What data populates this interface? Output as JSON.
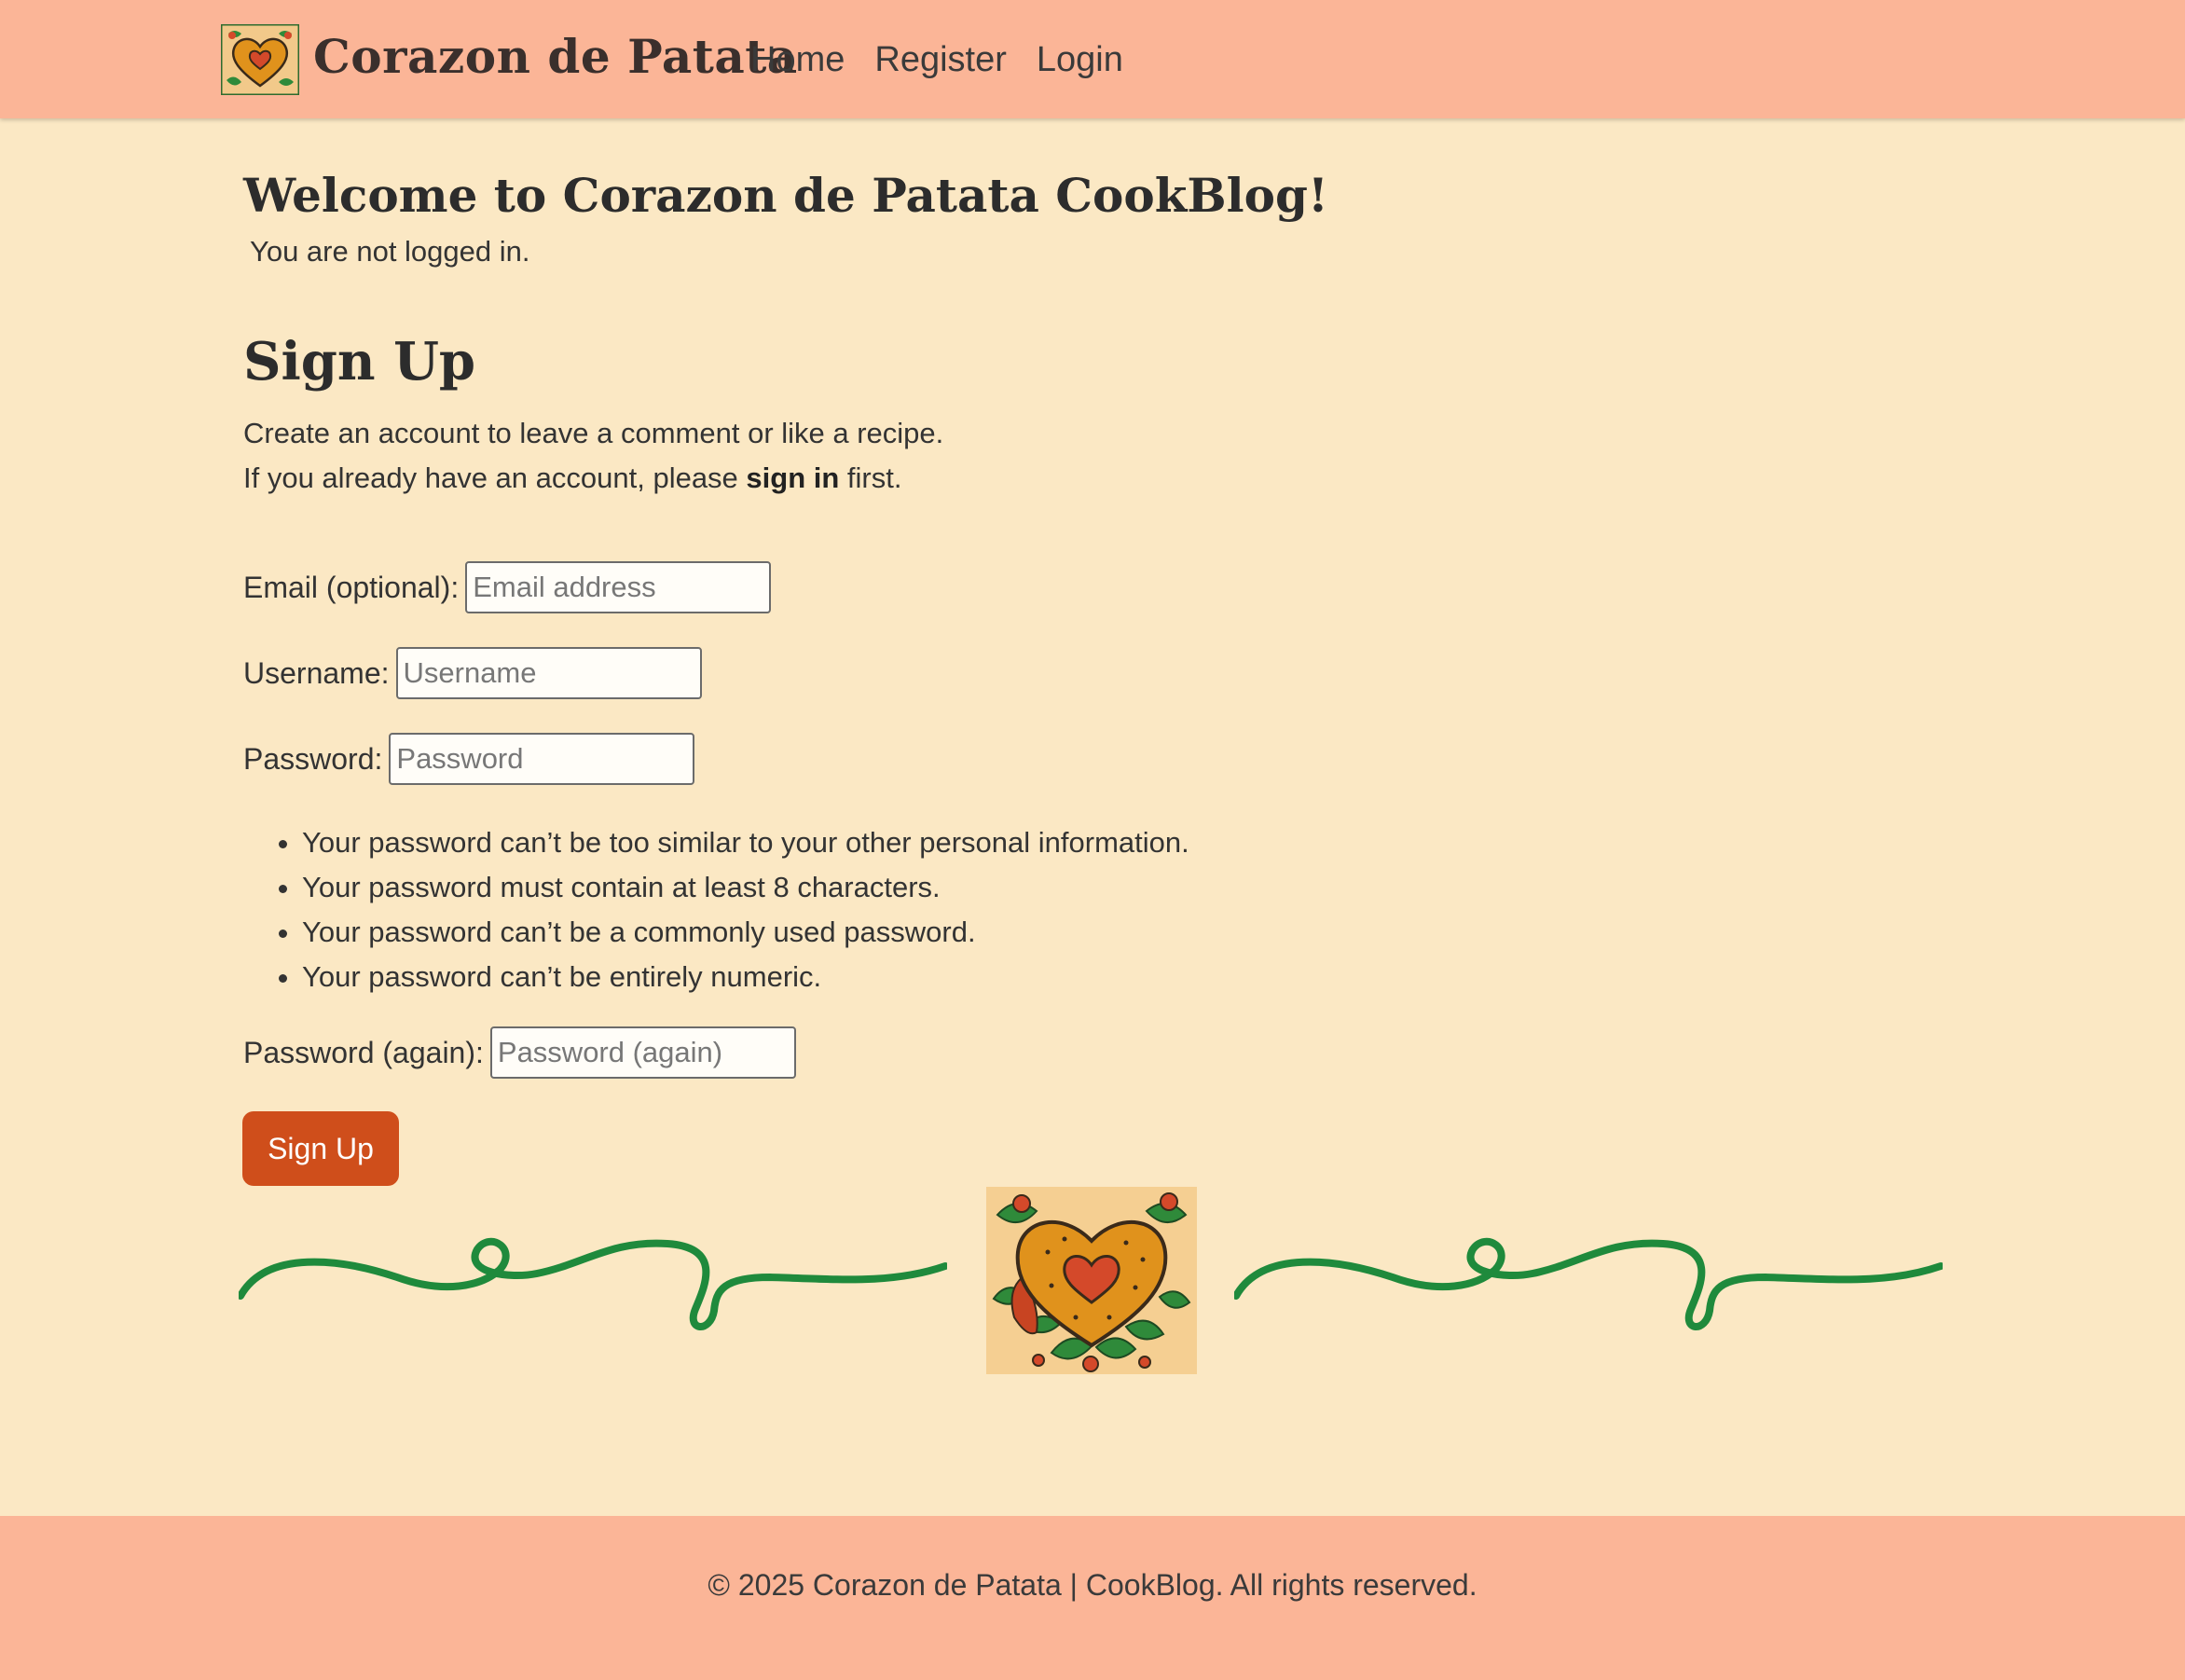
{
  "header": {
    "brand_name": "Corazon de Patata",
    "nav": [
      {
        "label": "Home"
      },
      {
        "label": "Register"
      },
      {
        "label": "Login"
      }
    ]
  },
  "main": {
    "welcome_title": "Welcome to Corazon de Patata CookBlog!",
    "login_status": "You are not logged in.",
    "signup_title": "Sign Up",
    "intro_line1": "Create an account to leave a comment or like a recipe.",
    "intro_line2_before": "If you already have an account, please ",
    "intro_line2_link": "sign in",
    "intro_line2_after": " first."
  },
  "form": {
    "email": {
      "label": "Email (optional):",
      "placeholder": "Email address",
      "value": ""
    },
    "username": {
      "label": "Username:",
      "placeholder": "Username",
      "value": ""
    },
    "password": {
      "label": "Password:",
      "placeholder": "Password",
      "value": ""
    },
    "password_help": [
      "Your password can’t be too similar to your other personal information.",
      "Your password must contain at least 8 characters.",
      "Your password can’t be a commonly used password.",
      "Your password can’t be entirely numeric."
    ],
    "password_again": {
      "label": "Password (again):",
      "placeholder": "Password (again)",
      "value": ""
    },
    "submit_label": "Sign Up"
  },
  "footer": {
    "text": "© 2025 Corazon de Patata | CookBlog. All rights reserved."
  },
  "icons": {
    "brand_logo": "heart-emblem-icon",
    "divider_left": "vine-flourish-icon",
    "divider_center": "heart-emblem-icon",
    "divider_right": "vine-flourish-icon"
  },
  "colors": {
    "navbar_bg": "#fbb597",
    "page_bg": "#fbe8c4",
    "button_bg": "#cf4e1b",
    "vine_green": "#1f8a3c",
    "heart_gold": "#e0921c",
    "heart_red": "#d4492a"
  }
}
